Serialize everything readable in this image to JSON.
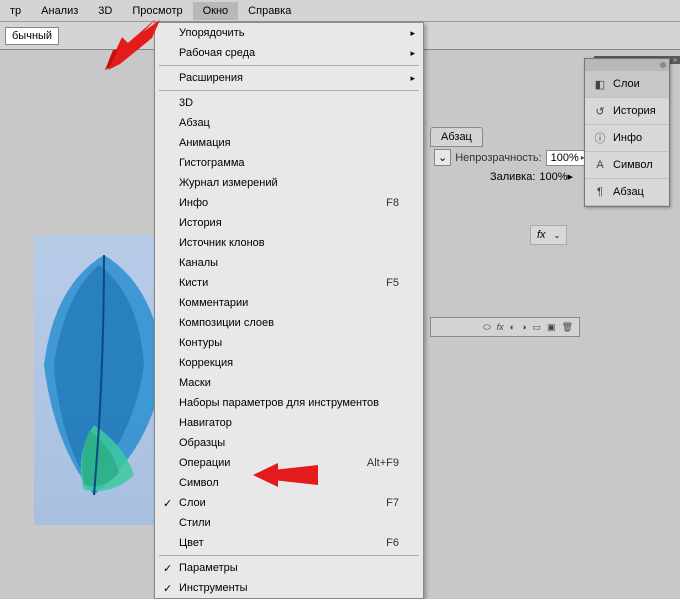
{
  "menubar": {
    "items": [
      "тр",
      "Анализ",
      "3D",
      "Просмотр",
      "Окно",
      "Справка"
    ],
    "active_idx": 4
  },
  "toolbar": {
    "mode": "бычный"
  },
  "dropdown": {
    "groups": [
      [
        {
          "label": "Упорядочить",
          "sub": true
        },
        {
          "label": "Рабочая среда",
          "sub": true
        }
      ],
      [
        {
          "label": "Расширения",
          "sub": true
        }
      ],
      [
        {
          "label": "3D"
        },
        {
          "label": "Абзац"
        },
        {
          "label": "Анимация"
        },
        {
          "label": "Гистограмма"
        },
        {
          "label": "Журнал измерений"
        },
        {
          "label": "Инфо",
          "shortcut": "F8"
        },
        {
          "label": "История"
        },
        {
          "label": "Источник клонов"
        },
        {
          "label": "Каналы"
        },
        {
          "label": "Кисти",
          "shortcut": "F5"
        },
        {
          "label": "Комментарии"
        },
        {
          "label": "Композиции слоев"
        },
        {
          "label": "Контуры"
        },
        {
          "label": "Коррекция"
        },
        {
          "label": "Маски"
        },
        {
          "label": "Наборы параметров для инструментов"
        },
        {
          "label": "Навигатор"
        },
        {
          "label": "Образцы"
        },
        {
          "label": "Операции",
          "shortcut": "Alt+F9"
        },
        {
          "label": "Символ"
        },
        {
          "label": "Слои",
          "shortcut": "F7",
          "checked": true
        },
        {
          "label": "Стили"
        },
        {
          "label": "Цвет",
          "shortcut": "F6"
        }
      ],
      [
        {
          "label": "Параметры",
          "checked": true
        },
        {
          "label": "Инструменты",
          "checked": true
        }
      ]
    ]
  },
  "panels": {
    "tab": "Абзац",
    "opacity_label": "Непрозрачность:",
    "opacity_value": "100%",
    "fill_label": "Заливка:",
    "fill_value": "100%",
    "fx_label": "fx"
  },
  "floating_panel": {
    "items": [
      {
        "icon": "layers-icon",
        "label": "Слои",
        "selected": true
      },
      {
        "icon": "history-icon",
        "label": "История"
      },
      {
        "icon": "info-icon",
        "label": "Инфо"
      },
      {
        "icon": "character-icon",
        "label": "Символ"
      },
      {
        "icon": "paragraph-icon",
        "label": "Абзац"
      }
    ]
  }
}
